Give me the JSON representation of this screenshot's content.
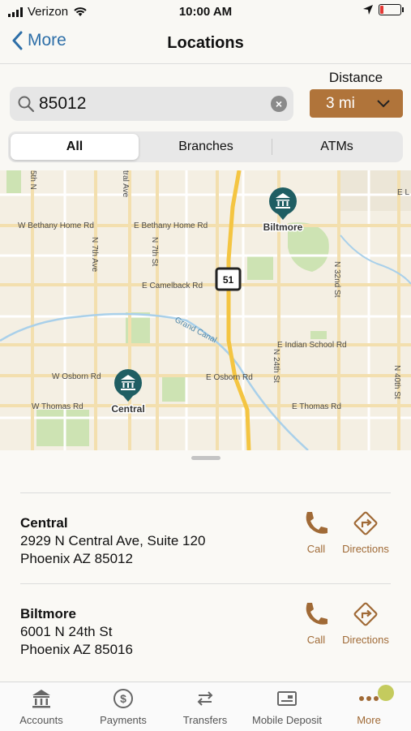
{
  "status_bar": {
    "carrier": "Verizon",
    "time": "10:00 AM"
  },
  "nav": {
    "back_label": "More",
    "title": "Locations"
  },
  "search": {
    "value": "85012"
  },
  "distance": {
    "label": "Distance",
    "value": "3 mi"
  },
  "segments": {
    "items": [
      "All",
      "Branches",
      "ATMs"
    ],
    "selected": "All"
  },
  "map": {
    "streets": [
      "W Bethany Home Rd",
      "E Bethany Home Rd",
      "E Camelback Rd",
      "E Indian School Rd",
      "W Osborn Rd",
      "E Osborn Rd",
      "W Thomas Rd",
      "E Thomas Rd",
      "N 7th Ave",
      "N 7th St",
      "N 24th St",
      "N 32nd St",
      "N 40th St",
      "Grand Canal",
      "E L",
      "5th N",
      "tral Ave"
    ],
    "highway_shield": "51",
    "pins": [
      "Biltmore",
      "Central"
    ]
  },
  "locations": [
    {
      "name": "Central",
      "address1": "2929 N Central Ave, Suite 120",
      "address2": "Phoenix AZ 85012",
      "call_label": "Call",
      "directions_label": "Directions"
    },
    {
      "name": "Biltmore",
      "address1": "6001 N 24th St",
      "address2": "Phoenix AZ 85016",
      "call_label": "Call",
      "directions_label": "Directions"
    }
  ],
  "tabbar": {
    "items": [
      "Accounts",
      "Payments",
      "Transfers",
      "Mobile Deposit",
      "More"
    ],
    "selected": "More"
  },
  "colors": {
    "accent": "#a06a36",
    "distance_button": "#b0743a",
    "link": "#2e6fa8",
    "pin": "#1f5e63"
  }
}
